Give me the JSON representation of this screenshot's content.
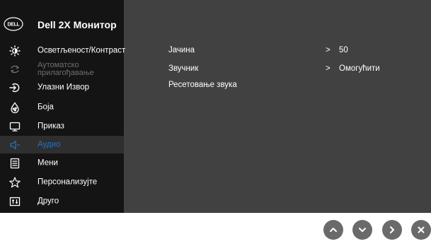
{
  "osd": {
    "title": "Dell 2X Монитор",
    "brand_logo": "DELL",
    "menu": [
      {
        "label": "Осветљеност/Контраст",
        "icon": "brightness-icon",
        "state": "normal"
      },
      {
        "label": "Аутоматско прилагођавање",
        "label_line1": "Аутоматско",
        "label_line2": "прилагођавање",
        "icon": "auto-adjust-icon",
        "state": "disabled"
      },
      {
        "label": "Улазни Извор",
        "icon": "input-source-icon",
        "state": "normal"
      },
      {
        "label": "Боја",
        "icon": "color-icon",
        "state": "normal"
      },
      {
        "label": "Приказ",
        "icon": "display-icon",
        "state": "normal"
      },
      {
        "label": "Аудио",
        "icon": "audio-icon",
        "state": "selected"
      },
      {
        "label": "Мени",
        "icon": "menu-icon",
        "state": "normal"
      },
      {
        "label": "Персонализујте",
        "icon": "star-icon",
        "state": "normal"
      },
      {
        "label": "Друго",
        "icon": "other-icon",
        "state": "normal"
      }
    ],
    "submenu": [
      {
        "label": "Јачина",
        "arrow": ">",
        "value": "50"
      },
      {
        "label": "Звучник",
        "arrow": ">",
        "value": "Омогућити"
      },
      {
        "label": "Ресетовање звука",
        "arrow": "",
        "value": ""
      }
    ],
    "colors": {
      "panel": "#414141",
      "sidebar": "#141414",
      "selected_bg": "#2f2f2f",
      "selected_text": "#2b6fbd",
      "disabled_text": "#6e6e6e",
      "button": "#6a6a6a"
    }
  },
  "buttons": [
    {
      "name": "up",
      "icon": "chevron-up-icon"
    },
    {
      "name": "down",
      "icon": "chevron-down-icon"
    },
    {
      "name": "right",
      "icon": "chevron-right-icon"
    },
    {
      "name": "close",
      "icon": "close-icon"
    }
  ]
}
